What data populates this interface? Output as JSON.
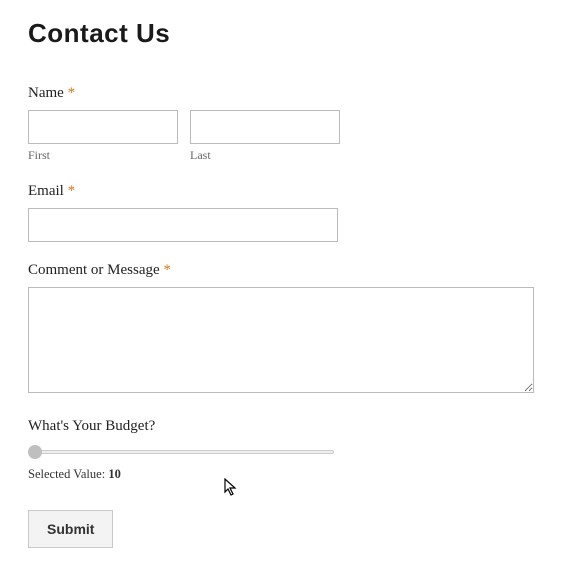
{
  "title": "Contact Us",
  "required_marker": "*",
  "name": {
    "label": "Name",
    "first_value": "",
    "last_value": "",
    "first_sublabel": "First",
    "last_sublabel": "Last"
  },
  "email": {
    "label": "Email",
    "value": ""
  },
  "message": {
    "label": "Comment or Message",
    "value": ""
  },
  "budget": {
    "label": "What's Your Budget?",
    "selected_label": "Selected Value: ",
    "value": "10"
  },
  "submit_label": "Submit"
}
